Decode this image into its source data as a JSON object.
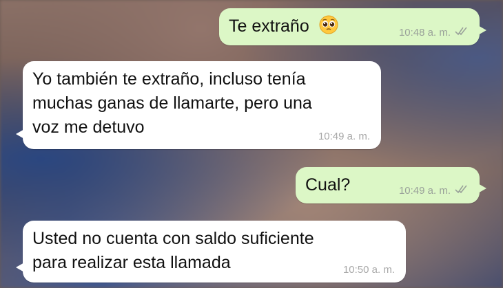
{
  "conversation": {
    "messages": [
      {
        "direction": "outgoing",
        "text": "Te extraño",
        "emoji": "pleading-face-icon",
        "time": "10:48 a. m.",
        "status": "double-check-read"
      },
      {
        "direction": "incoming",
        "text": "Yo también te extraño, incluso tenía\nmuchas ganas de llamarte, pero una\nvoz me detuvo",
        "time": "10:49 a. m."
      },
      {
        "direction": "outgoing",
        "text": "Cual?",
        "time": "10:49 a. m.",
        "status": "double-check-read"
      },
      {
        "direction": "incoming",
        "text": "Usted no cuenta con saldo suficiente\npara realizar esta llamada",
        "time": "10:50 a. m."
      }
    ]
  },
  "colors": {
    "outgoing_bubble": "#dcf7c6",
    "incoming_bubble": "#ffffff",
    "timestamp": "#9aa29a"
  }
}
